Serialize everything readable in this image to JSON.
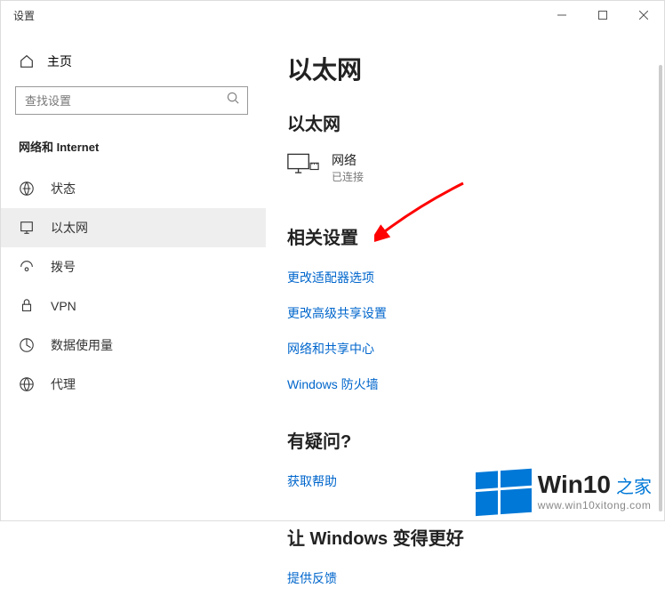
{
  "window": {
    "title": "设置"
  },
  "sidebar": {
    "home": "主页",
    "search_placeholder": "查找设置",
    "section": "网络和 Internet",
    "items": [
      {
        "label": "状态"
      },
      {
        "label": "以太网"
      },
      {
        "label": "拨号"
      },
      {
        "label": "VPN"
      },
      {
        "label": "数据使用量"
      },
      {
        "label": "代理"
      }
    ]
  },
  "main": {
    "title": "以太网",
    "sub_title": "以太网",
    "network": {
      "name": "网络",
      "status": "已连接"
    },
    "related_title": "相关设置",
    "links": [
      "更改适配器选项",
      "更改高级共享设置",
      "网络和共享中心",
      "Windows 防火墙"
    ],
    "question_title": "有疑问?",
    "question_link": "获取帮助",
    "improve_title": "让 Windows 变得更好",
    "improve_link": "提供反馈"
  },
  "watermark": {
    "main": "Win10",
    "sub": "之家",
    "url": "www.win10xitong.com"
  }
}
